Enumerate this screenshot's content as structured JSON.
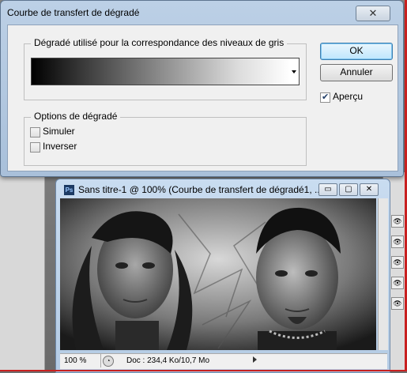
{
  "dialog": {
    "title": "Courbe de transfert de dégradé",
    "close_glyph": "✕",
    "gradient_group_label": "Dégradé utilisé pour la correspondance des niveaux de gris",
    "options_group_label": "Options de dégradé",
    "options": [
      {
        "label": "Simuler",
        "checked": false
      },
      {
        "label": "Inverser",
        "checked": false
      }
    ],
    "ok_label": "OK",
    "cancel_label": "Annuler",
    "preview_label": "Aperçu",
    "preview_checked": true
  },
  "document": {
    "icon_text": "Ps",
    "title": "Sans titre-1 @ 100% (Courbe de transfert de dégradé1, ...",
    "min_glyph": "▭",
    "max_glyph": "▢",
    "close_glyph": "✕",
    "zoom": "100 %",
    "info": "Doc : 234,4 Ko/10,7 Mo"
  }
}
